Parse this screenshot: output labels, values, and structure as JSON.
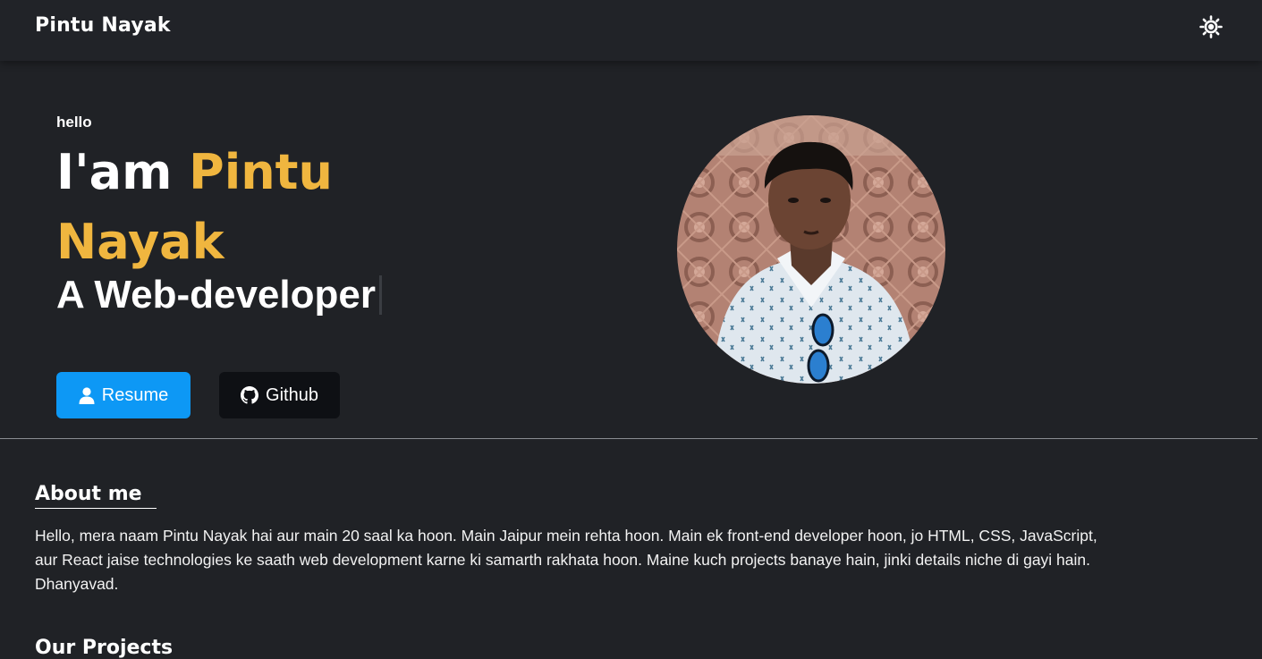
{
  "nav": {
    "brand": "Pintu Nayak",
    "theme_toggle_icon": "sun-icon"
  },
  "hero": {
    "greeting": "hello",
    "title_prefix": "I'am ",
    "title_name": "Pintu Nayak",
    "role": "A Web-developer",
    "accent_color": "#f0b63f",
    "resume_button": {
      "label": "Resume",
      "icon": "user-icon",
      "color": "#0d98f5"
    },
    "github_button": {
      "label": "Github",
      "icon": "github-icon",
      "color": "#0e1014"
    },
    "photo_alt": "Pintu Nayak"
  },
  "about": {
    "heading": "About me",
    "text": "Hello, mera naam Pintu Nayak hai aur main 20 saal ka hoon. Main Jaipur mein rehta hoon. Main ek front-end developer hoon, jo HTML, CSS, JavaScript, aur React jaise technologies ke saath web development karne ki samarth rakhata hoon. Maine kuch projects banaye hain, jinki details niche di gayi hain. Dhanyavad."
  },
  "projects": {
    "heading": "Our Projects"
  }
}
